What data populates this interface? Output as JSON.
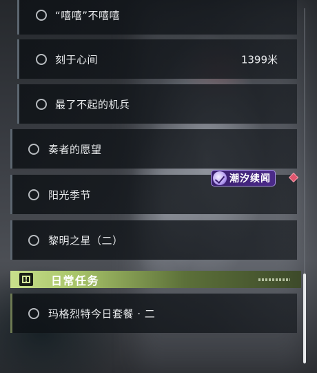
{
  "quests": [
    {
      "label": "“嘻嘻”不嘻嘻",
      "distance": ""
    },
    {
      "label": "刻于心间",
      "distance": "1399米"
    },
    {
      "label": "最了不起的机兵",
      "distance": ""
    },
    {
      "label": "奏者的愿望",
      "distance": ""
    },
    {
      "label": "阳光季节",
      "distance": ""
    },
    {
      "label": "黎明之星（二）",
      "distance": ""
    }
  ],
  "event_tag": {
    "label": "潮汐续闻",
    "icon": "tide-event-icon"
  },
  "daily_section": {
    "title": "日常任务",
    "icon": "exclamation-icon",
    "quests": [
      {
        "label": "玛格烈特今日套餐 · 二"
      }
    ]
  },
  "colors": {
    "section_accent": "#c9e08c",
    "tag_bg": "#4b2a8a",
    "marker": "#e0566e"
  }
}
